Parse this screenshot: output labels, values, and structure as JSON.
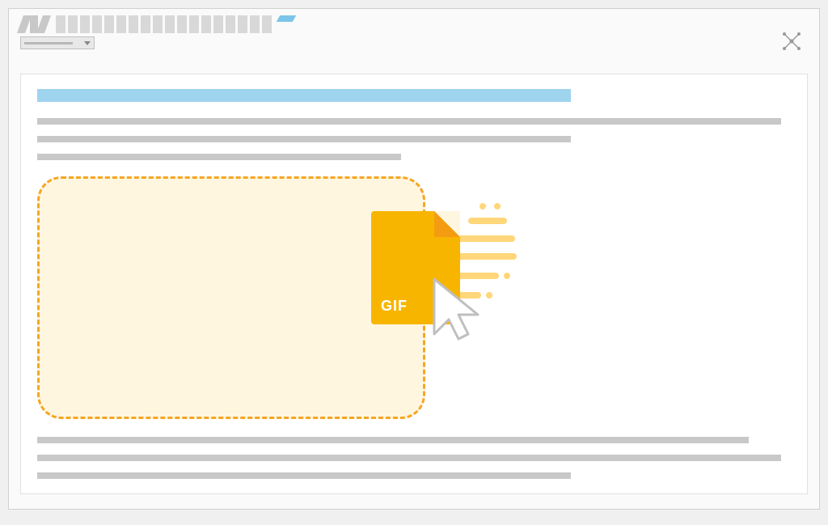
{
  "file": {
    "label": "GIF",
    "type": "gif-file"
  },
  "colors": {
    "accent_blue": "#9fd4ee",
    "accent_orange": "#f5a623",
    "file_yellow": "#f7b500",
    "dropzone_bg": "#fff6e0"
  },
  "layout": {
    "type": "document-editor",
    "action": "drag-and-drop-media"
  }
}
